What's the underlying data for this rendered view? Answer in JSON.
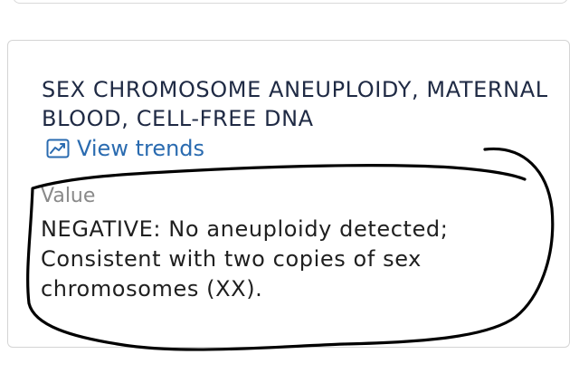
{
  "result": {
    "title": "SEX CHROMOSOME ANEUPLOIDY, MATERNAL BLOOD, CELL-FREE DNA",
    "trends_link_label": "View trends",
    "trends_icon": "trend-chart-icon",
    "value_label": "Value",
    "value_text": "NEGATIVE: No aneuploidy detected; Consistent with two copies of sex chromosomes (XX)."
  },
  "colors": {
    "title": "#1f2a44",
    "link": "#2a6bb0",
    "muted_label": "#8a8a8a",
    "annotation_ink": "#000000"
  }
}
